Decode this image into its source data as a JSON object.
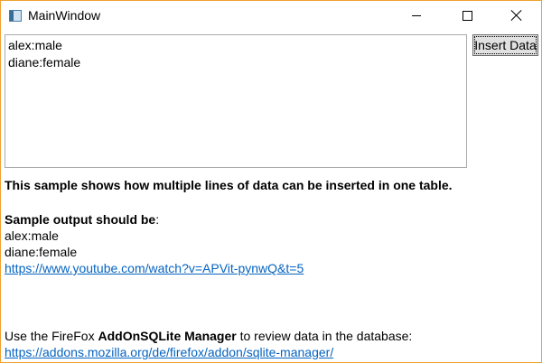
{
  "window": {
    "title": "MainWindow",
    "accent_border_color": "#f0a030",
    "controls": [
      "minimize-icon",
      "maximize-icon",
      "close-icon"
    ]
  },
  "textbox": {
    "lines": [
      "alex:male",
      "diane:female"
    ]
  },
  "insert_button": {
    "label": "Insert Data"
  },
  "description": {
    "heading": "This sample shows how multiple lines of data can be inserted in one table.",
    "sample_label": "Sample output should be",
    "sample_suffix": ":",
    "sample_lines": [
      "alex:male",
      "diane:female"
    ],
    "video_link": "https://www.youtube.com/watch?v=APVit-pynwQ&t=5"
  },
  "footer": {
    "prefix": "Use the FireFox ",
    "tool_name": "AddOnSQLite Manager",
    "suffix": " to review data in the database:",
    "addon_link": "https://addons.mozilla.org/de/firefox/addon/sqlite-manager/"
  }
}
